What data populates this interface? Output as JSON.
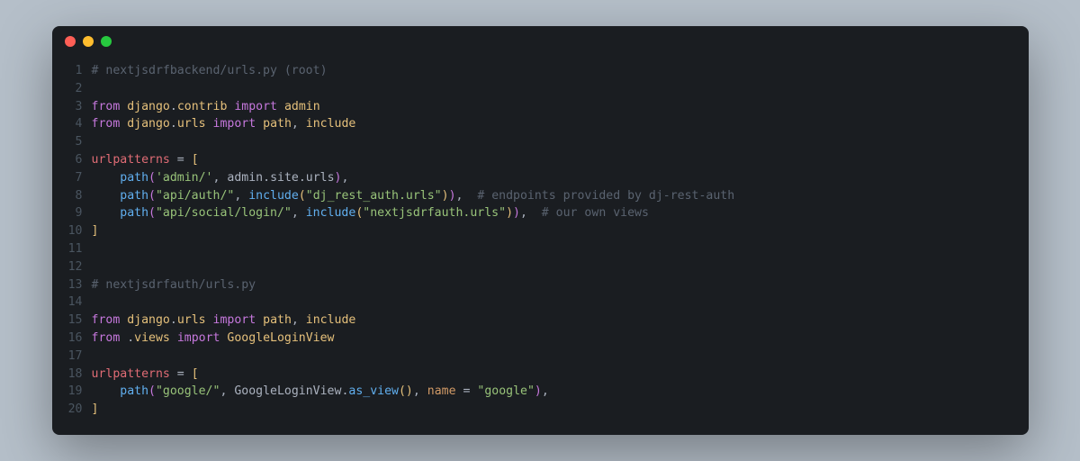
{
  "window": {
    "traffic_lights": [
      "close",
      "minimize",
      "maximize"
    ]
  },
  "code": {
    "lines": [
      {
        "n": 1,
        "tokens": [
          [
            "comment",
            "# nextjsdrfbackend/urls.py (root)"
          ]
        ]
      },
      {
        "n": 2,
        "tokens": []
      },
      {
        "n": 3,
        "tokens": [
          [
            "keyword",
            "from"
          ],
          [
            "default",
            " "
          ],
          [
            "module",
            "django"
          ],
          [
            "punct",
            "."
          ],
          [
            "module",
            "contrib"
          ],
          [
            "default",
            " "
          ],
          [
            "keyword",
            "import"
          ],
          [
            "default",
            " "
          ],
          [
            "module",
            "admin"
          ]
        ]
      },
      {
        "n": 4,
        "tokens": [
          [
            "keyword",
            "from"
          ],
          [
            "default",
            " "
          ],
          [
            "module",
            "django"
          ],
          [
            "punct",
            "."
          ],
          [
            "module",
            "urls"
          ],
          [
            "default",
            " "
          ],
          [
            "keyword",
            "import"
          ],
          [
            "default",
            " "
          ],
          [
            "module",
            "path"
          ],
          [
            "punct",
            ", "
          ],
          [
            "module",
            "include"
          ]
        ]
      },
      {
        "n": 5,
        "tokens": []
      },
      {
        "n": 6,
        "tokens": [
          [
            "ident",
            "urlpatterns"
          ],
          [
            "default",
            " "
          ],
          [
            "punct",
            "="
          ],
          [
            "default",
            " "
          ],
          [
            "paren",
            "["
          ]
        ]
      },
      {
        "n": 7,
        "tokens": [
          [
            "default",
            "    "
          ],
          [
            "builtin",
            "path"
          ],
          [
            "paren2",
            "("
          ],
          [
            "string",
            "'admin/'"
          ],
          [
            "punct",
            ", "
          ],
          [
            "default",
            "admin"
          ],
          [
            "punct",
            "."
          ],
          [
            "default",
            "site"
          ],
          [
            "punct",
            "."
          ],
          [
            "default",
            "urls"
          ],
          [
            "paren2",
            ")"
          ],
          [
            "punct",
            ","
          ]
        ]
      },
      {
        "n": 8,
        "tokens": [
          [
            "default",
            "    "
          ],
          [
            "builtin",
            "path"
          ],
          [
            "paren2",
            "("
          ],
          [
            "string",
            "\"api/auth/\""
          ],
          [
            "punct",
            ", "
          ],
          [
            "builtin",
            "include"
          ],
          [
            "paren",
            "("
          ],
          [
            "string",
            "\"dj_rest_auth.urls\""
          ],
          [
            "paren",
            ")"
          ],
          [
            "paren2",
            ")"
          ],
          [
            "punct",
            ",  "
          ],
          [
            "comment",
            "# endpoints provided by dj-rest-auth"
          ]
        ]
      },
      {
        "n": 9,
        "tokens": [
          [
            "default",
            "    "
          ],
          [
            "builtin",
            "path"
          ],
          [
            "paren2",
            "("
          ],
          [
            "string",
            "\"api/social/login/\""
          ],
          [
            "punct",
            ", "
          ],
          [
            "builtin",
            "include"
          ],
          [
            "paren",
            "("
          ],
          [
            "string",
            "\"nextjsdrfauth.urls\""
          ],
          [
            "paren",
            ")"
          ],
          [
            "paren2",
            ")"
          ],
          [
            "punct",
            ",  "
          ],
          [
            "comment",
            "# our own views"
          ]
        ]
      },
      {
        "n": 10,
        "tokens": [
          [
            "paren",
            "]"
          ]
        ]
      },
      {
        "n": 11,
        "tokens": []
      },
      {
        "n": 12,
        "tokens": []
      },
      {
        "n": 13,
        "tokens": [
          [
            "comment",
            "# nextjsdrfauth/urls.py"
          ]
        ]
      },
      {
        "n": 14,
        "tokens": []
      },
      {
        "n": 15,
        "tokens": [
          [
            "keyword",
            "from"
          ],
          [
            "default",
            " "
          ],
          [
            "module",
            "django"
          ],
          [
            "punct",
            "."
          ],
          [
            "module",
            "urls"
          ],
          [
            "default",
            " "
          ],
          [
            "keyword",
            "import"
          ],
          [
            "default",
            " "
          ],
          [
            "module",
            "path"
          ],
          [
            "punct",
            ", "
          ],
          [
            "module",
            "include"
          ]
        ]
      },
      {
        "n": 16,
        "tokens": [
          [
            "keyword",
            "from"
          ],
          [
            "default",
            " ."
          ],
          [
            "module",
            "views"
          ],
          [
            "default",
            " "
          ],
          [
            "keyword",
            "import"
          ],
          [
            "default",
            " "
          ],
          [
            "module",
            "GoogleLoginView"
          ]
        ]
      },
      {
        "n": 17,
        "tokens": []
      },
      {
        "n": 18,
        "tokens": [
          [
            "ident",
            "urlpatterns"
          ],
          [
            "default",
            " "
          ],
          [
            "punct",
            "="
          ],
          [
            "default",
            " "
          ],
          [
            "paren",
            "["
          ]
        ]
      },
      {
        "n": 19,
        "tokens": [
          [
            "default",
            "    "
          ],
          [
            "builtin",
            "path"
          ],
          [
            "paren2",
            "("
          ],
          [
            "string",
            "\"google/\""
          ],
          [
            "punct",
            ", "
          ],
          [
            "default",
            "GoogleLoginView"
          ],
          [
            "punct",
            "."
          ],
          [
            "builtin",
            "as_view"
          ],
          [
            "paren",
            "("
          ],
          [
            "paren",
            ")"
          ],
          [
            "punct",
            ", "
          ],
          [
            "param",
            "name"
          ],
          [
            "default",
            " "
          ],
          [
            "punct",
            "="
          ],
          [
            "default",
            " "
          ],
          [
            "string",
            "\"google\""
          ],
          [
            "paren2",
            ")"
          ],
          [
            "punct",
            ","
          ]
        ]
      },
      {
        "n": 20,
        "tokens": [
          [
            "paren",
            "]"
          ]
        ]
      }
    ]
  }
}
